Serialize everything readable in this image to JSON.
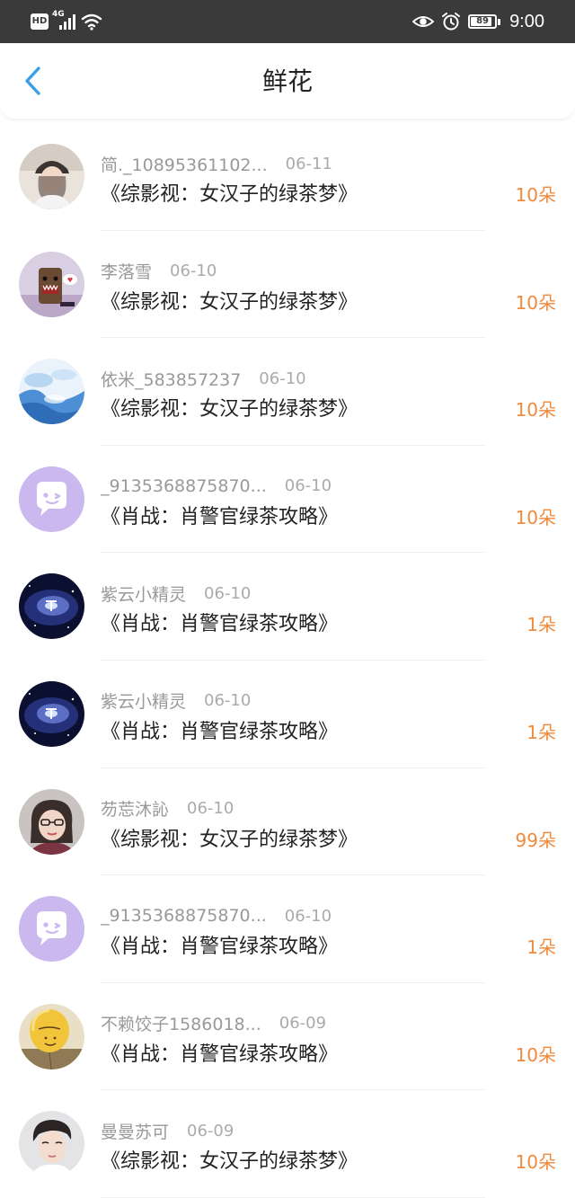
{
  "status_bar": {
    "hd_label": "HD",
    "signal_label": "4G",
    "battery_level": "89",
    "time": "9:00"
  },
  "header": {
    "title": "鲜花"
  },
  "colors": {
    "accent": "#3aa0e6",
    "flower_count": "#f08a3c",
    "status_bar_bg": "#3a3a3a"
  },
  "items": [
    {
      "username": "简._10895361102...",
      "date": "06-11",
      "book": "《综影视：女汉子的绿茶梦》",
      "flowers": "10朵",
      "avatar": "photo-girl-cap"
    },
    {
      "username": "李落雪",
      "date": "06-10",
      "book": "《综影视：女汉子的绿茶梦》",
      "flowers": "10朵",
      "avatar": "domo-character"
    },
    {
      "username": "依米_583857237",
      "date": "06-10",
      "book": "《综影视：女汉子的绿茶梦》",
      "flowers": "10朵",
      "avatar": "blue-clouds"
    },
    {
      "username": "_9135368875870...",
      "date": "06-10",
      "book": "《肖战：肖警官绿茶攻略》",
      "flowers": "10朵",
      "avatar": "default-chat-bubble"
    },
    {
      "username": "紫云小精灵",
      "date": "06-10",
      "book": "《肖战：肖警官绿茶攻略》",
      "flowers": "1朵",
      "avatar": "galaxy"
    },
    {
      "username": "紫云小精灵",
      "date": "06-10",
      "book": "《肖战：肖警官绿茶攻略》",
      "flowers": "1朵",
      "avatar": "galaxy"
    },
    {
      "username": "芴莣沐訫",
      "date": "06-10",
      "book": "《综影视：女汉子的绿茶梦》",
      "flowers": "99朵",
      "avatar": "photo-woman-glasses"
    },
    {
      "username": "_9135368875870...",
      "date": "06-10",
      "book": "《肖战：肖警官绿茶攻略》",
      "flowers": "1朵",
      "avatar": "default-chat-bubble"
    },
    {
      "username": "不赖饺子1586018...",
      "date": "06-09",
      "book": "《肖战：肖警官绿茶攻略》",
      "flowers": "10朵",
      "avatar": "smile-balloon"
    },
    {
      "username": "曼曼苏可",
      "date": "06-09",
      "book": "《综影视：女汉子的绿茶梦》",
      "flowers": "10朵",
      "avatar": "photo-young-man"
    }
  ]
}
